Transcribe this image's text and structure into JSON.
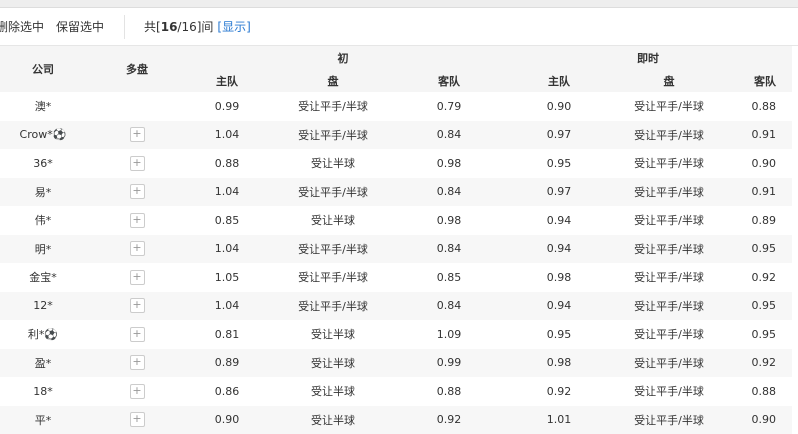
{
  "toolbar": {
    "delete_selected": "删除选中",
    "keep_selected": "保留选中",
    "count_prefix": "共[",
    "count_shown": "16",
    "count_suffix": "/16]间",
    "show_link": "[显示]"
  },
  "header": {
    "company": "公司",
    "multi": "多盘",
    "initial": "初",
    "live": "即时",
    "home": "主队",
    "line": "盘",
    "away": "客队"
  },
  "rows": [
    {
      "company": "澳*",
      "multi": false,
      "i_home": "0.99",
      "i_line": "受让平手/半球",
      "i_away": "0.79",
      "l_home": "0.90",
      "l_line": "受让平手/半球",
      "l_away": "0.88"
    },
    {
      "company": "Crow*⚽",
      "multi": true,
      "i_home": "1.04",
      "i_line": "受让平手/半球",
      "i_away": "0.84",
      "l_home": "0.97",
      "l_line": "受让平手/半球",
      "l_away": "0.91"
    },
    {
      "company": "36*",
      "multi": true,
      "i_home": "0.88",
      "i_line": "受让半球",
      "i_away": "0.98",
      "l_home": "0.95",
      "l_line": "受让平手/半球",
      "l_away": "0.90"
    },
    {
      "company": "易*",
      "multi": true,
      "i_home": "1.04",
      "i_line": "受让平手/半球",
      "i_away": "0.84",
      "l_home": "0.97",
      "l_line": "受让平手/半球",
      "l_away": "0.91"
    },
    {
      "company": "伟*",
      "multi": true,
      "i_home": "0.85",
      "i_line": "受让半球",
      "i_away": "0.98",
      "l_home": "0.94",
      "l_line": "受让平手/半球",
      "l_away": "0.89"
    },
    {
      "company": "明*",
      "multi": true,
      "i_home": "1.04",
      "i_line": "受让平手/半球",
      "i_away": "0.84",
      "l_home": "0.94",
      "l_line": "受让平手/半球",
      "l_away": "0.95"
    },
    {
      "company": "金宝*",
      "multi": true,
      "i_home": "1.05",
      "i_line": "受让平手/半球",
      "i_away": "0.85",
      "l_home": "0.98",
      "l_line": "受让平手/半球",
      "l_away": "0.92"
    },
    {
      "company": "12*",
      "multi": true,
      "i_home": "1.04",
      "i_line": "受让平手/半球",
      "i_away": "0.84",
      "l_home": "0.94",
      "l_line": "受让平手/半球",
      "l_away": "0.95"
    },
    {
      "company": "利*⚽",
      "multi": true,
      "i_home": "0.81",
      "i_line": "受让半球",
      "i_away": "1.09",
      "l_home": "0.95",
      "l_line": "受让平手/半球",
      "l_away": "0.95"
    },
    {
      "company": "盈*",
      "multi": true,
      "i_home": "0.89",
      "i_line": "受让半球",
      "i_away": "0.99",
      "l_home": "0.98",
      "l_line": "受让平手/半球",
      "l_away": "0.92"
    },
    {
      "company": "18*",
      "multi": true,
      "i_home": "0.86",
      "i_line": "受让半球",
      "i_away": "0.88",
      "l_home": "0.92",
      "l_line": "受让平手/半球",
      "l_away": "0.88"
    },
    {
      "company": "平*",
      "multi": true,
      "i_home": "0.90",
      "i_line": "受让半球",
      "i_away": "0.92",
      "l_home": "1.01",
      "l_line": "受让平手/半球",
      "l_away": "0.90"
    }
  ]
}
